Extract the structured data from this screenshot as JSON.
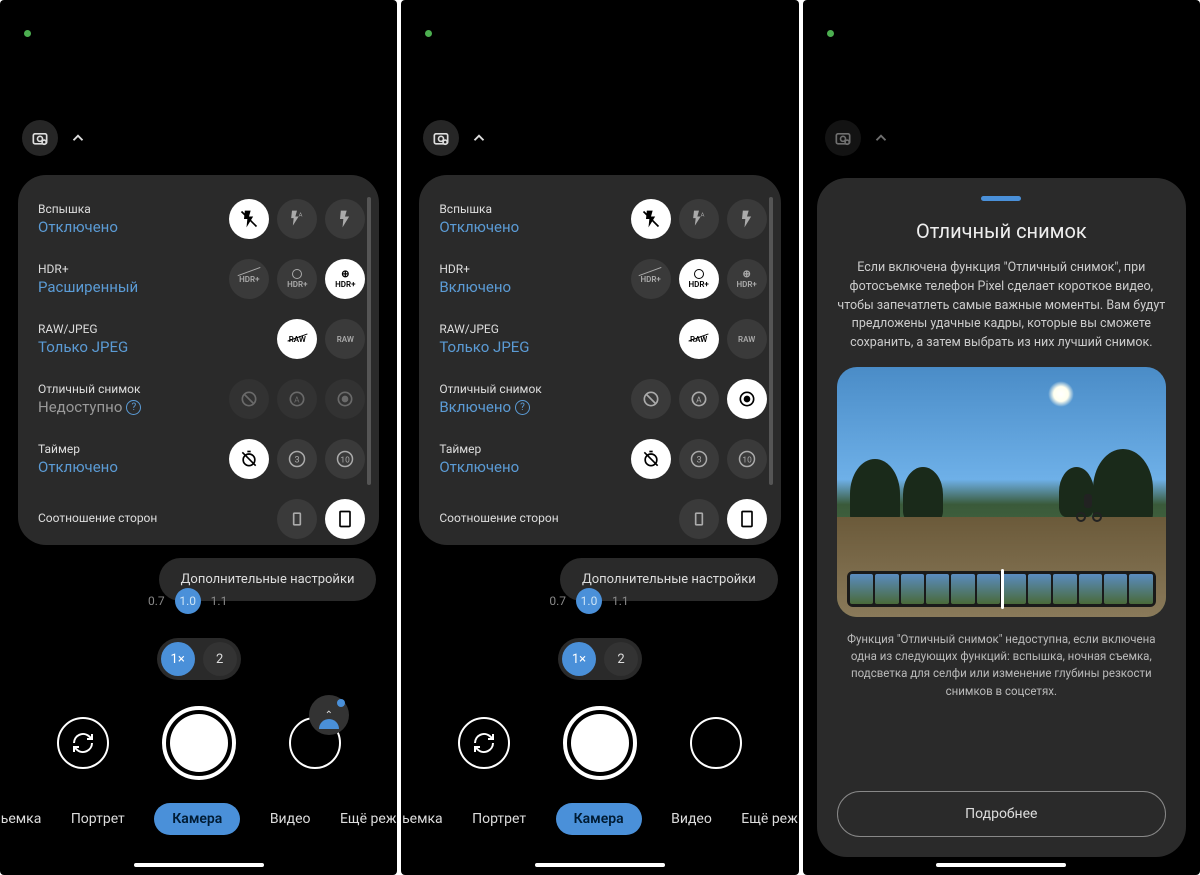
{
  "colors": {
    "accent": "#4a90d9",
    "link": "#5b9bd5"
  },
  "common": {
    "more_settings": "Дополнительные настройки",
    "zoom_small": {
      "a": "0.7",
      "b": "1.0",
      "c": "1.1"
    },
    "zoom_big": {
      "one": "1×",
      "two": "2"
    },
    "modes": {
      "left_cut": "ьемка",
      "portrait": "Портрет",
      "camera": "Камера",
      "video": "Видео",
      "right_cut": "Ещё реж"
    }
  },
  "p1": {
    "flash": {
      "title": "Вспышка",
      "value": "Отключено",
      "selected": 0
    },
    "hdr": {
      "title": "HDR+",
      "value": "Расширенный",
      "selected": 2,
      "opts": [
        "hdr-off",
        "hdr-on",
        "hdr-plus"
      ]
    },
    "raw": {
      "title": "RAW/JPEG",
      "value": "Только JPEG",
      "selected": 0,
      "opts": [
        "jpeg",
        "raw"
      ]
    },
    "topshot": {
      "title": "Отличный снимок",
      "value": "Недоступно",
      "value_gray": true,
      "help": true,
      "opts": [
        "off",
        "auto",
        "on"
      ],
      "selected": -1
    },
    "timer": {
      "title": "Таймер",
      "value": "Отключено",
      "selected": 0,
      "opts": [
        "timer-off",
        "timer-3",
        "timer-10"
      ]
    },
    "ratio": {
      "title": "Соотношение сторон"
    }
  },
  "p2": {
    "flash": {
      "title": "Вспышка",
      "value": "Отключено",
      "selected": 0
    },
    "hdr": {
      "title": "HDR+",
      "value": "Включено",
      "selected": 1,
      "opts": [
        "hdr-off",
        "hdr-on",
        "hdr-plus"
      ]
    },
    "raw": {
      "title": "RAW/JPEG",
      "value": "Только JPEG",
      "selected": 0,
      "opts": [
        "jpeg",
        "raw"
      ]
    },
    "topshot": {
      "title": "Отличный снимок",
      "value": "Включено",
      "help": true,
      "opts": [
        "off",
        "auto",
        "on"
      ],
      "selected": 2
    },
    "timer": {
      "title": "Таймер",
      "value": "Отключено",
      "selected": 0,
      "opts": [
        "timer-off",
        "timer-3",
        "timer-10"
      ]
    },
    "ratio": {
      "title": "Соотношение сторон"
    }
  },
  "p3": {
    "title": "Отличный снимок",
    "body": "Если включена функция \"Отличный снимок\", при фотосъемке телефон Pixel сделает короткое видео, чтобы запечатлеть самые важные моменты. Вам будут предложены удачные кадры, которые вы сможете сохранить, а затем выбрать из них лучший снимок.",
    "note": "Функция \"Отличный снимок\" недоступна, если включена одна из следующих функций: вспышка, ночная съемка, подсветка для селфи или изменение глубины резкости снимков в соцсетях.",
    "button": "Подробнее"
  }
}
